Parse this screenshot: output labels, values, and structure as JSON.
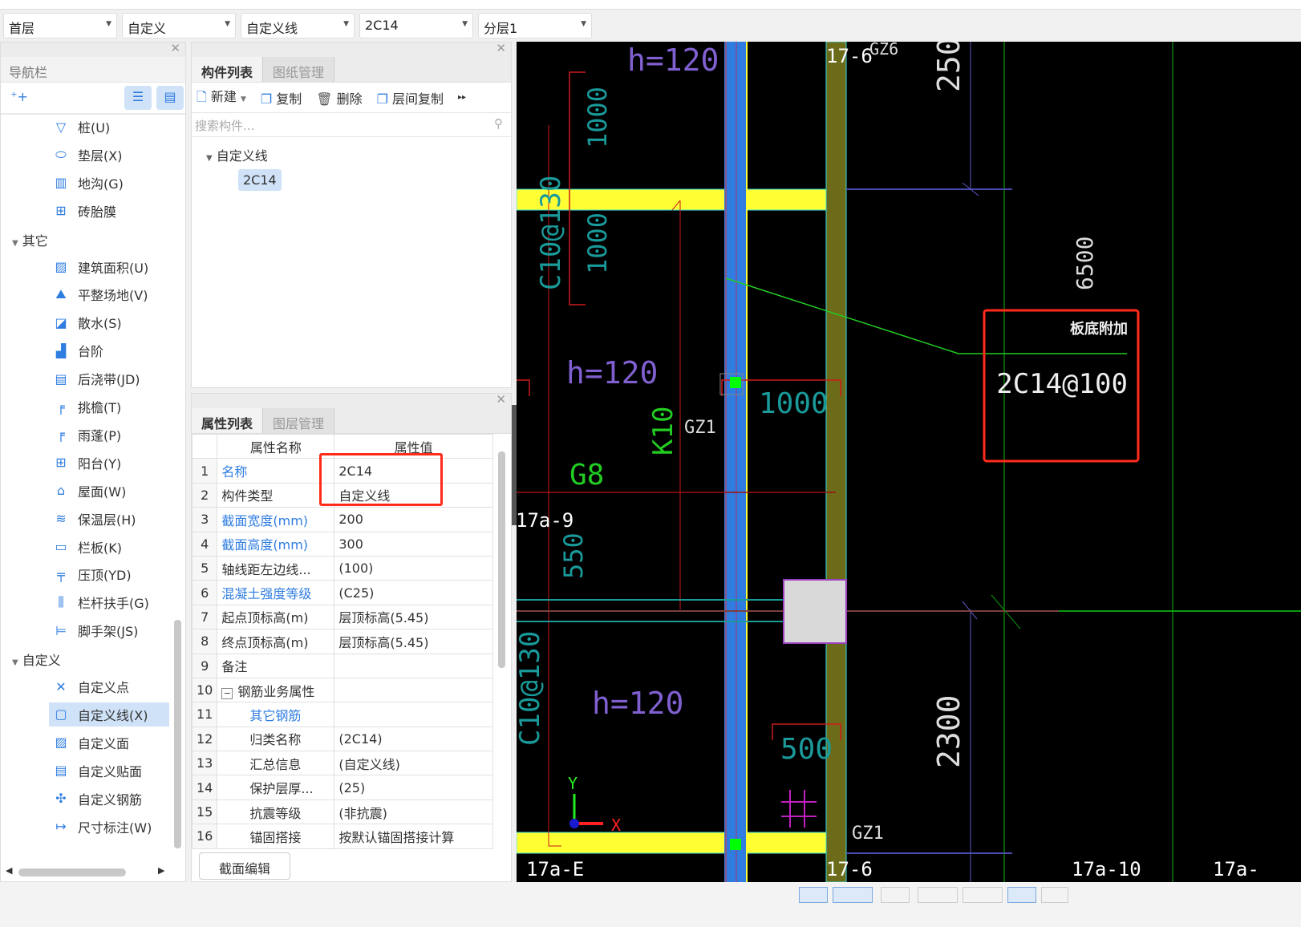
{
  "toolbar": {
    "dropdowns": [
      "首层",
      "自定义",
      "自定义线",
      "2C14",
      "分层1"
    ]
  },
  "nav": {
    "title": "导航栏",
    "items": [
      {
        "label": "桩(U)",
        "icon": "pile-icon",
        "g": "▽"
      },
      {
        "label": "垫层(X)",
        "icon": "cushion-icon",
        "g": "⬭"
      },
      {
        "label": "地沟(G)",
        "icon": "trench-icon",
        "g": "▥"
      },
      {
        "label": "砖胎膜",
        "icon": "brick-mold-icon",
        "g": "⊞"
      },
      {
        "group": "其它"
      },
      {
        "label": "建筑面积(U)",
        "icon": "building-area-icon",
        "g": "▨"
      },
      {
        "label": "平整场地(V)",
        "icon": "site-leveling-icon",
        "g": "⛰"
      },
      {
        "label": "散水(S)",
        "icon": "apron-icon",
        "g": "◪"
      },
      {
        "label": "台阶",
        "icon": "steps-icon",
        "g": "▟"
      },
      {
        "label": "后浇带(JD)",
        "icon": "post-pour-strip-icon",
        "g": "▤"
      },
      {
        "label": "挑檐(T)",
        "icon": "eave-icon",
        "g": "╒"
      },
      {
        "label": "雨蓬(P)",
        "icon": "canopy-icon",
        "g": "╒"
      },
      {
        "label": "阳台(Y)",
        "icon": "balcony-icon",
        "g": "⊞"
      },
      {
        "label": "屋面(W)",
        "icon": "roof-icon",
        "g": "⌂"
      },
      {
        "label": "保温层(H)",
        "icon": "insulation-icon",
        "g": "≋"
      },
      {
        "label": "栏板(K)",
        "icon": "parapet-icon",
        "g": "▭"
      },
      {
        "label": "压顶(YD)",
        "icon": "coping-icon",
        "g": "╤"
      },
      {
        "label": "栏杆扶手(G)",
        "icon": "railing-icon",
        "g": "⫼"
      },
      {
        "label": "脚手架(JS)",
        "icon": "scaffold-icon",
        "g": "⊨"
      },
      {
        "group": "自定义"
      },
      {
        "label": "自定义点",
        "icon": "custom-point-icon",
        "g": "✕"
      },
      {
        "label": "自定义线(X)",
        "icon": "custom-line-icon",
        "g": "▢",
        "selected": true
      },
      {
        "label": "自定义面",
        "icon": "custom-face-icon",
        "g": "▨"
      },
      {
        "label": "自定义贴面",
        "icon": "custom-veneer-icon",
        "g": "▤"
      },
      {
        "label": "自定义钢筋",
        "icon": "custom-rebar-icon",
        "g": "✣"
      },
      {
        "label": "尺寸标注(W)",
        "icon": "dimension-icon",
        "g": "↦"
      }
    ]
  },
  "components": {
    "tabs": [
      "构件列表",
      "图纸管理"
    ],
    "actions": {
      "new": "新建",
      "copy": "复制",
      "delete": "删除",
      "floor_copy": "层间复制"
    },
    "search_placeholder": "搜索构件...",
    "tree_group": "自定义线",
    "tree_item": "2C14"
  },
  "properties": {
    "tabs": [
      "属性列表",
      "图层管理"
    ],
    "headers": [
      "属性名称",
      "属性值"
    ],
    "rows": [
      {
        "n": "1",
        "k": "名称",
        "v": "2C14",
        "blue": true
      },
      {
        "n": "2",
        "k": "构件类型",
        "v": "自定义线"
      },
      {
        "n": "3",
        "k": "截面宽度(mm)",
        "v": "200",
        "blue": true
      },
      {
        "n": "4",
        "k": "截面高度(mm)",
        "v": "300",
        "blue": true
      },
      {
        "n": "5",
        "k": "轴线距左边线...",
        "v": "(100)"
      },
      {
        "n": "6",
        "k": "混凝土强度等级",
        "v": "(C25)",
        "blue": true
      },
      {
        "n": "7",
        "k": "起点顶标高(m)",
        "v": "层顶标高(5.45)"
      },
      {
        "n": "8",
        "k": "终点顶标高(m)",
        "v": "层顶标高(5.45)"
      },
      {
        "n": "9",
        "k": "备注",
        "v": ""
      },
      {
        "n": "10",
        "k": "钢筋业务属性",
        "v": "",
        "expander": "−"
      },
      {
        "n": "11",
        "k": "其它钢筋",
        "v": "",
        "blue": true,
        "indent": true
      },
      {
        "n": "12",
        "k": "归类名称",
        "v": "(2C14)",
        "indent": true
      },
      {
        "n": "13",
        "k": "汇总信息",
        "v": "(自定义线)",
        "indent": true
      },
      {
        "n": "14",
        "k": "保护层厚...",
        "v": "(25)",
        "indent": true
      },
      {
        "n": "15",
        "k": "抗震等级",
        "v": "(非抗震)",
        "indent": true
      },
      {
        "n": "16",
        "k": "锚固搭接",
        "v": "按默认锚固搭接计算",
        "indent": true
      }
    ],
    "section_edit": "截面编辑"
  },
  "cad": {
    "labels": {
      "h1": "h=120",
      "h2": "h=120",
      "h3": "h=120",
      "d1000a": "1000",
      "d1000b": "1000",
      "d1000c": "1000",
      "c10a": "C10@130",
      "c10b": "C10@130",
      "k10": "K10",
      "gz1a": "GZ1",
      "gz1b": "GZ1",
      "gz6": "GZ6",
      "g8": "G8",
      "ax17a9": "17a-9",
      "d550": "550",
      "d500": "500",
      "d250": "250",
      "d6500": "6500",
      "d2300": "2300",
      "ax176top": "17-6",
      "ax17aE": "17a-E",
      "ax176": "17-6",
      "ax17a10": "17a-10",
      "ax17a": "17a-",
      "axis_x": "X",
      "axis_y": "Y"
    },
    "annotation": {
      "title": "板底附加",
      "text": "2C14@100"
    },
    "colors": {
      "highlight": "#ff2a1a",
      "beam": "#ffff33",
      "column": "#6b6b1a",
      "wall": "#2f7de1"
    }
  }
}
